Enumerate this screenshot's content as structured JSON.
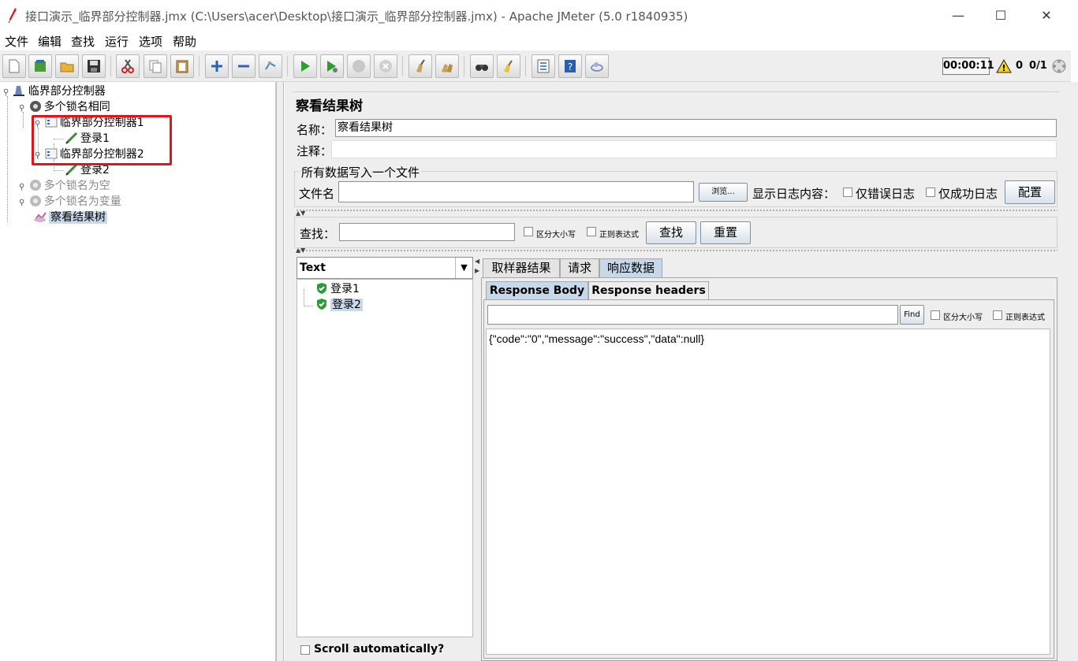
{
  "window": {
    "title": "接口演示_临界部分控制器.jmx (C:\\Users\\acer\\Desktop\\接口演示_临界部分控制器.jmx) - Apache JMeter (5.0 r1840935)",
    "minimize": "—",
    "maximize": "☐",
    "close": "✕"
  },
  "menu": [
    "文件",
    "编辑",
    "查找",
    "运行",
    "选项",
    "帮助"
  ],
  "toolbar": {
    "timer": "00:00:11",
    "warnings": "0",
    "threads": "0/1"
  },
  "tree": {
    "root": "临界部分控制器",
    "group1": "多个锁名相同",
    "ctrl1": "临界部分控制器1",
    "login1": "登录1",
    "ctrl2": "临界部分控制器2",
    "login2": "登录2",
    "group2": "多个锁名为空",
    "group3": "多个锁名为变量",
    "listener": "察看结果树"
  },
  "panel": {
    "title": "察看结果树",
    "name_label": "名称：",
    "name_value": "察看结果树",
    "comment_label": "注释：",
    "comment_value": "",
    "file_group_title": "所有数据写入一个文件",
    "filename_label": "文件名",
    "filename_value": "",
    "browse_button": "浏览...",
    "log_label": "显示日志内容：",
    "errors_only": "仅错误日志",
    "success_only": "仅成功日志",
    "configure_button": "配置"
  },
  "search": {
    "label": "查找：",
    "value": "",
    "case_sensitive": "区分大小写",
    "regex": "正则表达式",
    "find_button": "查找",
    "reset_button": "重置"
  },
  "results": {
    "renderer": "Text",
    "samples": [
      "登录1",
      "登录2"
    ],
    "scroll_auto": "Scroll automatically?"
  },
  "tabs": {
    "sampler_result": "取样器结果",
    "request": "请求",
    "response_data": "响应数据",
    "response_body": "Response Body",
    "response_headers": "Response headers"
  },
  "response": {
    "find_value": "",
    "find_button": "Find",
    "case_sensitive": "区分大小写",
    "regex": "正则表达式",
    "body": "{\"code\":\"0\",\"message\":\"success\",\"data\":null}"
  },
  "colors": {
    "accent_selected": "#c7d8ea",
    "highlight_border": "#e0141b",
    "success_green": "#2e9a3a"
  }
}
